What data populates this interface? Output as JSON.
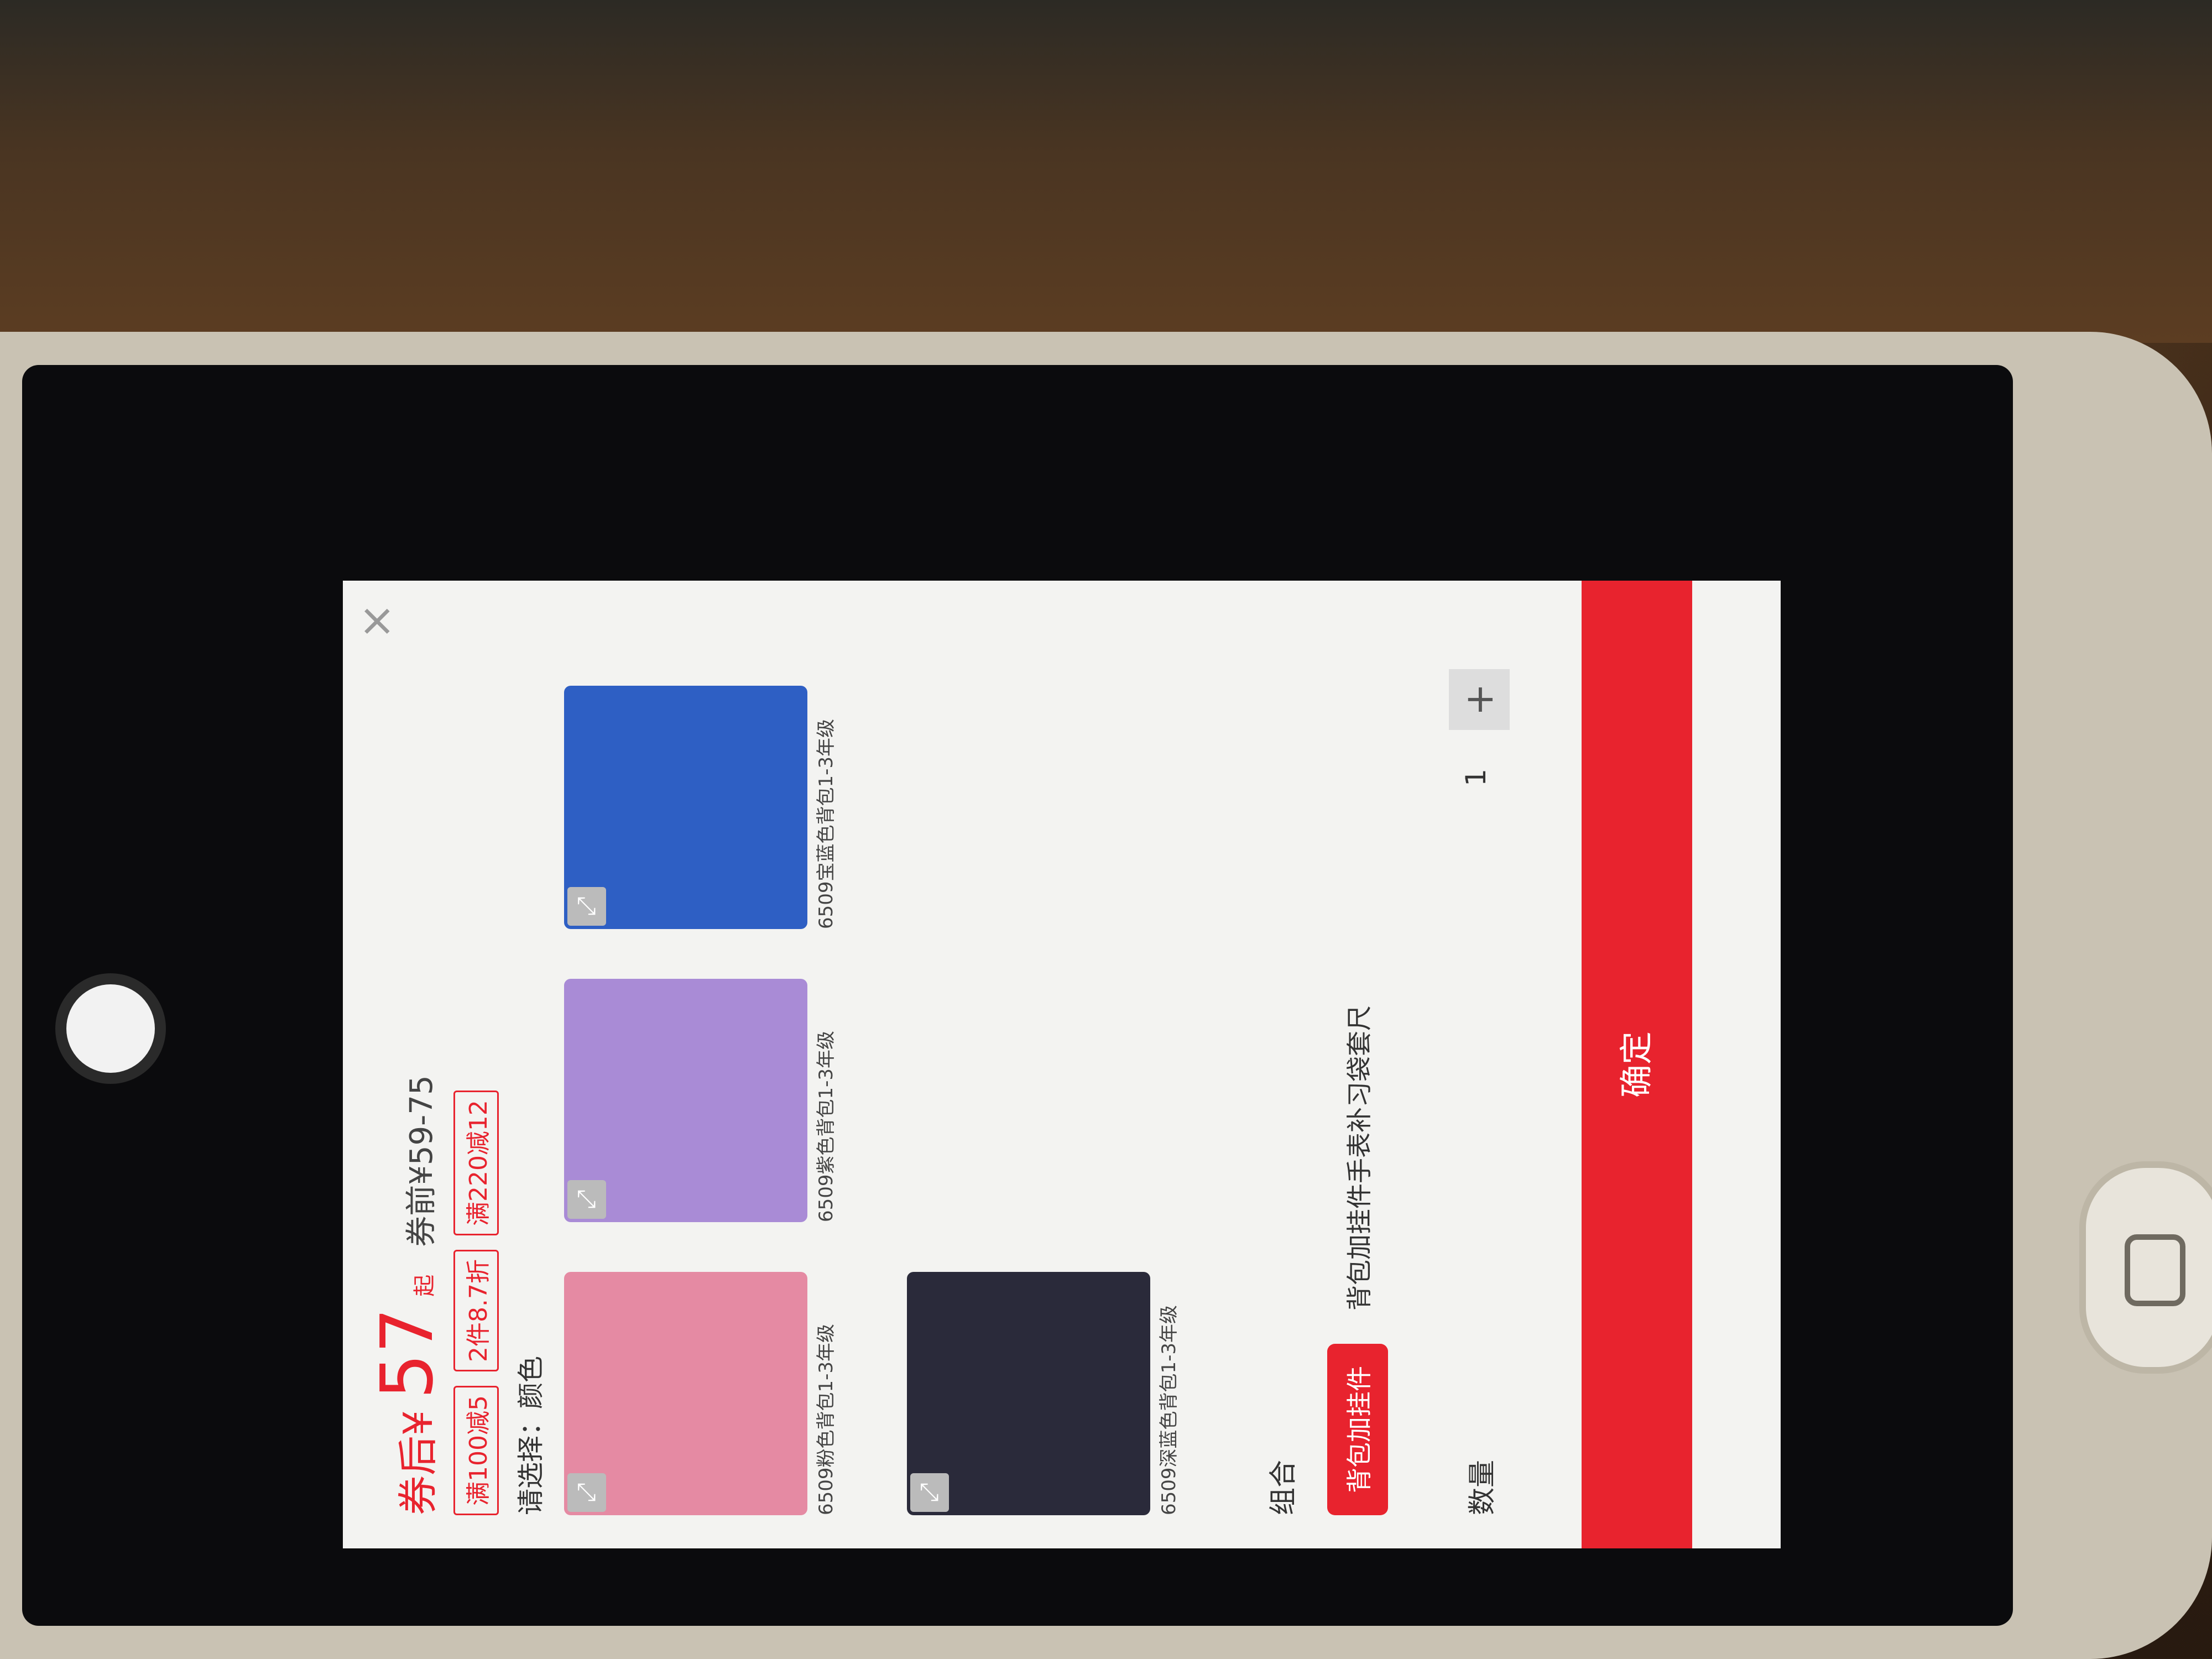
{
  "price": {
    "prefix": "券后¥",
    "main": "57",
    "suffix": "起",
    "original": "券前¥59-75"
  },
  "promos": [
    "满100减5",
    "2件8.7折",
    "满220减12"
  ],
  "select_label": "请选择：颜色",
  "products": [
    {
      "name": "6509粉色背包1-3年级",
      "color": "#e58aa3"
    },
    {
      "name": "6509紫色背包1-3年级",
      "color": "#a98bd6"
    },
    {
      "name": "6509宝蓝色背包1-3年级",
      "color": "#2e5fc4"
    },
    {
      "name": "6509深蓝色背包1-3年级",
      "color": "#2a2a3a"
    }
  ],
  "combo": {
    "label": "组合",
    "options": [
      "背包加挂件",
      "背包加挂件手表补习袋套尺"
    ]
  },
  "quantity": {
    "label": "数量",
    "value": "1",
    "plus": "+"
  },
  "confirm": "确定",
  "close": "×"
}
